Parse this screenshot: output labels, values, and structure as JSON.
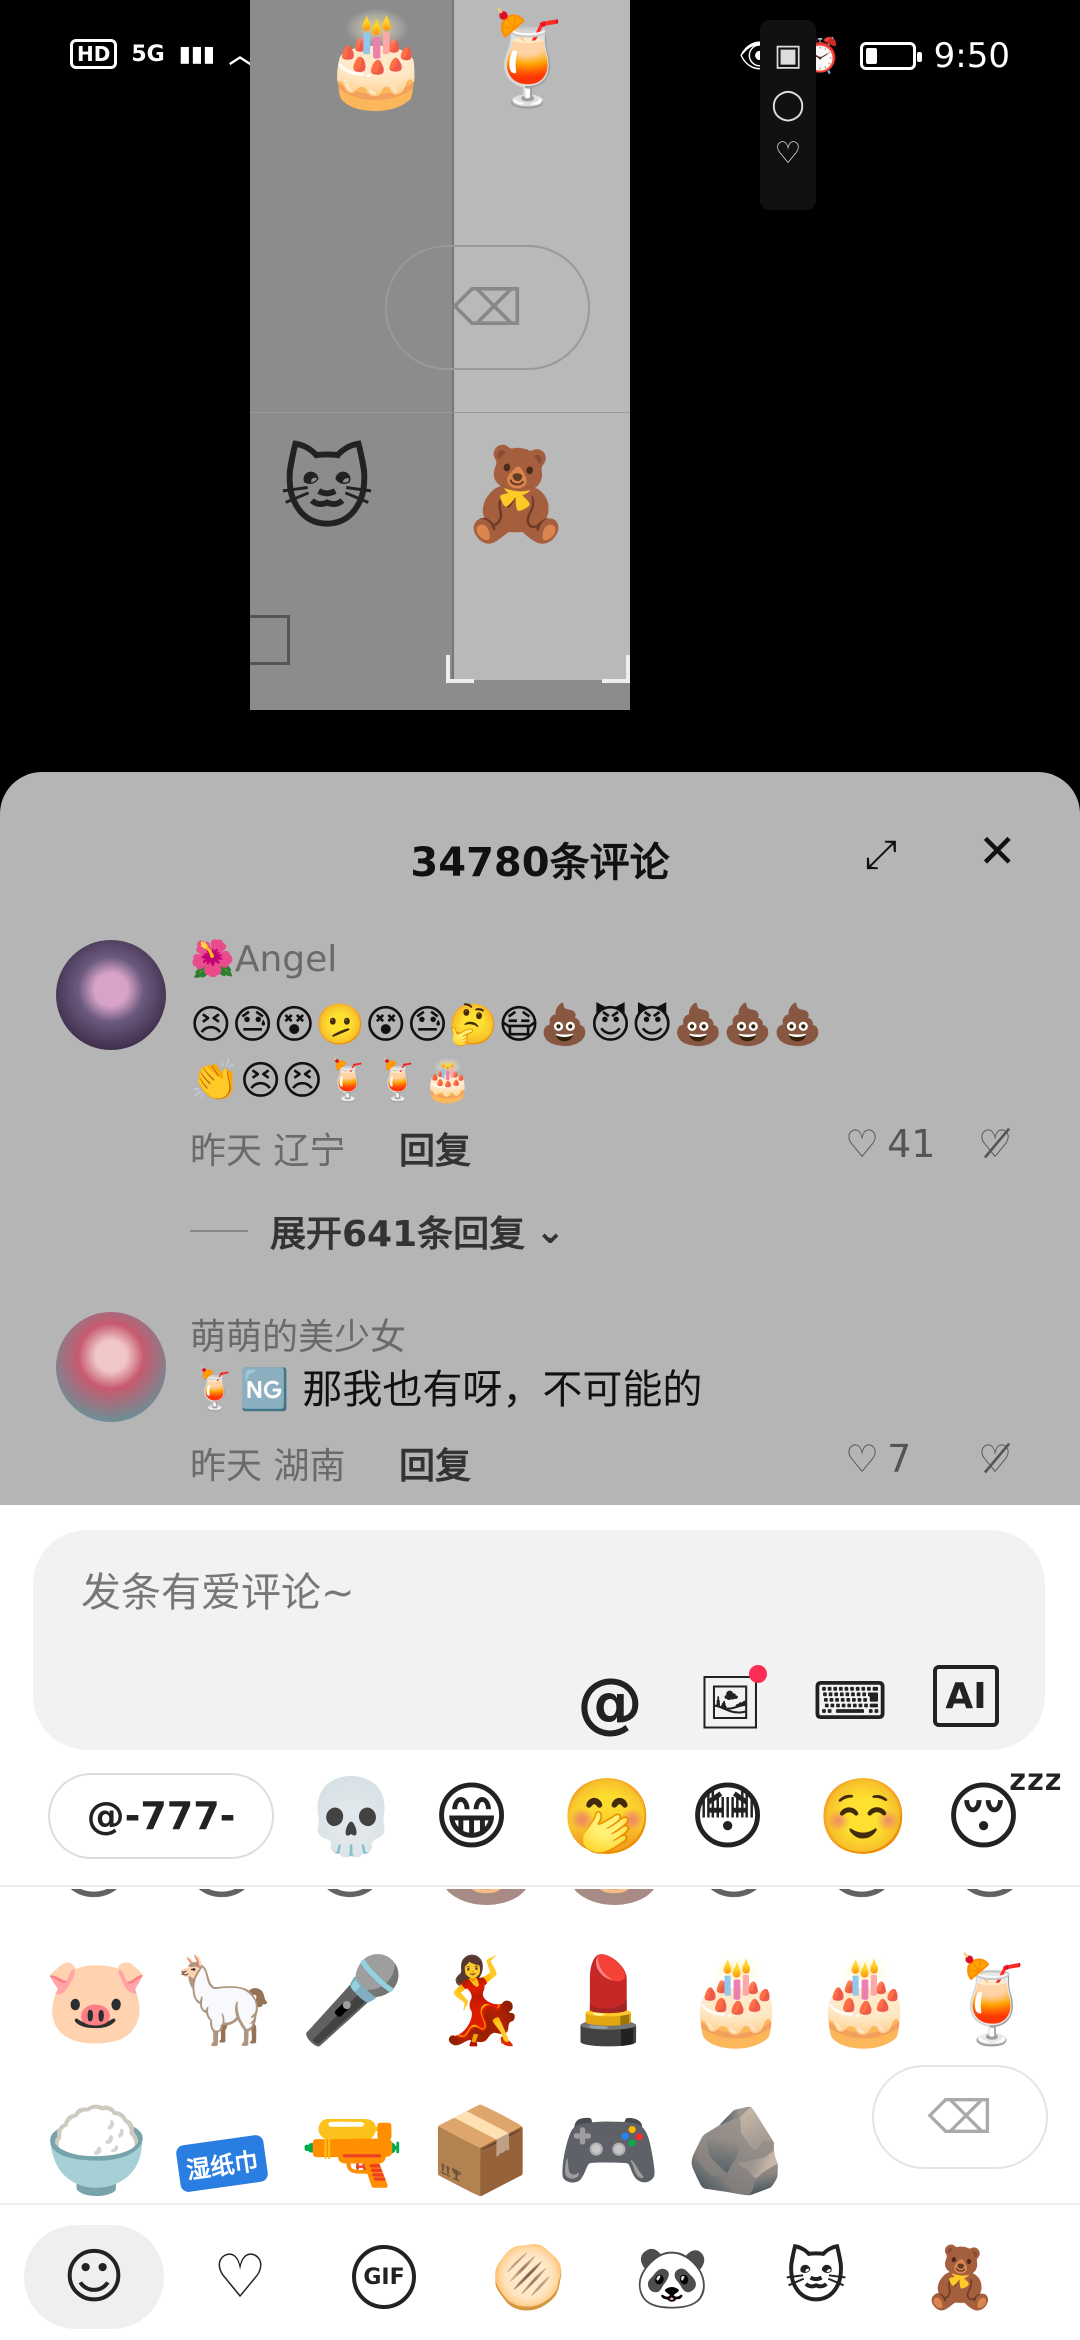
{
  "status_bar": {
    "hd": "HD",
    "network": "5G",
    "signal_icon": "signal-icon",
    "wifi_icon": "wifi-icon",
    "wechat_icon": "wechat-icon",
    "eye_icon": "eye-icon",
    "alarm_icon": "alarm-icon",
    "battery_level": 0.22,
    "time": "9:50"
  },
  "video_preview": {
    "emojis": [
      "🎂",
      "🍹",
      "🐱",
      "🧸"
    ],
    "delete_glyph": "⌫"
  },
  "side_controls": [
    "▣",
    "◯",
    "♡"
  ],
  "comments_header": {
    "title": "34780条评论",
    "expand_icon": "⤢",
    "close_icon": "✕"
  },
  "comments": [
    {
      "username": "🌺Angel",
      "text_line1": "😣😓😵🫤😵😓🤔😷💩😈😈💩💩💩",
      "text_line2": "👏😣😣🍹🍹🎂",
      "time": "昨天",
      "location": "辽宁",
      "reply_label": "回复",
      "likes": "41",
      "expand_replies": "展开641条回复"
    },
    {
      "username": "萌萌的美少女",
      "text_prefix": "🍹🆖",
      "text": "那我也有呀，不可能的",
      "time": "昨天",
      "location": "湖南",
      "reply_label": "回复",
      "likes": "7"
    }
  ],
  "input": {
    "placeholder": "发条有爱评论~",
    "tools": {
      "at": "@",
      "image": "🖼",
      "keyboard": "⌨",
      "ai": "AI"
    }
  },
  "quick_row": {
    "mention": "@-777-",
    "emojis": [
      "💀",
      "😁",
      "🤭",
      "😳",
      "☺️",
      "😴"
    ]
  },
  "emoji_grid": {
    "row_partial": [
      "😊",
      "😊",
      "🐱",
      "🐻",
      "🐻",
      "😊",
      "😊",
      "😊"
    ],
    "row1": [
      "🐷",
      "🦙",
      "🎤",
      "💃",
      "💄",
      "🎂",
      "🎂",
      "🍹"
    ],
    "row2": [
      "🍚",
      "",
      "🔫",
      "📦",
      "🎮",
      "🪨"
    ],
    "wet_wipes_text": "湿纸巾",
    "delete_glyph": "⌫"
  },
  "tabs": [
    "☺",
    "♡",
    "GIF",
    "🫓",
    "🐼",
    "🐱",
    "🧸"
  ]
}
